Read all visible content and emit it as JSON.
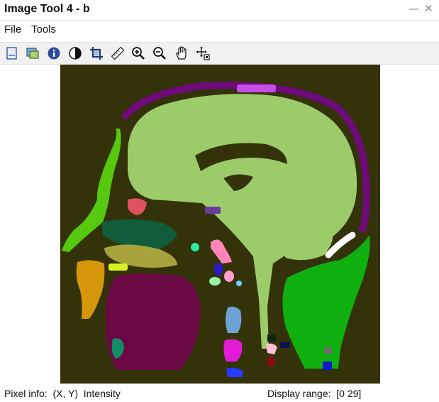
{
  "window": {
    "title": "Image Tool 4 - b",
    "minimize_glyph": "—",
    "close_glyph": "✕"
  },
  "menu": {
    "items": [
      {
        "label": "File"
      },
      {
        "label": "Tools"
      }
    ]
  },
  "toolbar": {
    "tools": [
      {
        "icon": "new-figure-icon"
      },
      {
        "icon": "export-image-icon"
      },
      {
        "icon": "image-info-icon"
      },
      {
        "icon": "contrast-icon"
      },
      {
        "icon": "crop-icon"
      },
      {
        "icon": "distance-tool-icon"
      },
      {
        "icon": "zoom-in-icon"
      },
      {
        "icon": "zoom-out-icon"
      },
      {
        "icon": "pan-hand-icon"
      },
      {
        "icon": "pixel-region-icon"
      }
    ]
  },
  "image": {
    "background_color": "#343209",
    "label_colors": {
      "brain": "#9ccc6a",
      "scalp": "#6d0b78",
      "tongue": "#6a0843",
      "neck": "#0fb00f",
      "face": "#55c80f",
      "jaw": "#d4970a",
      "palate": "#a7a33c",
      "nasal": "#115d3b",
      "top_patch": "#c64ee8"
    }
  },
  "status": {
    "pixel_info_label": "Pixel info:",
    "pixel_info_value": "(X, Y)  Intensity",
    "display_range_label": "Display range:",
    "display_range_value": "[0 29]"
  }
}
